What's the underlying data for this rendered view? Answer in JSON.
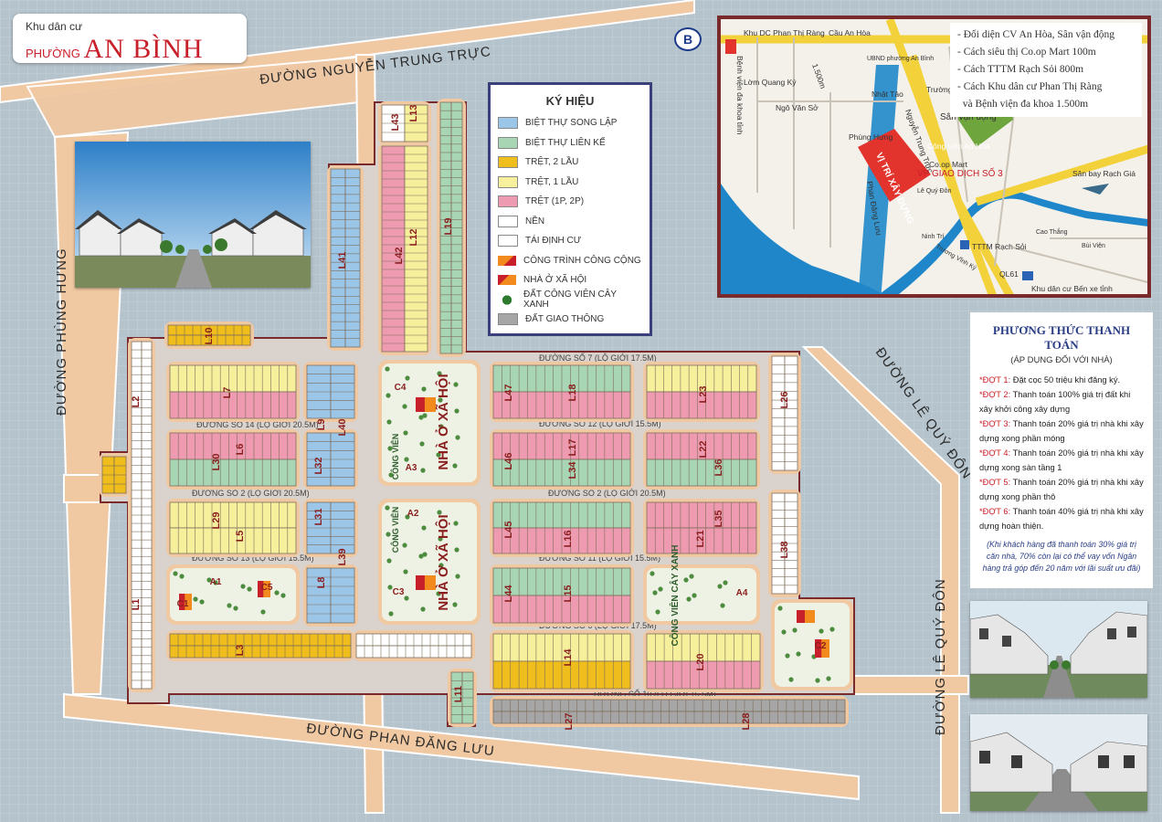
{
  "title": {
    "line1": "Khu dân cư",
    "prefix": "PHƯỜNG",
    "name": "AN BÌNH"
  },
  "north_badge": "B",
  "roads": {
    "nguyen_trung_truc": "ĐƯỜNG NGUYỄN TRUNG TRỰC",
    "phung_hung": "ĐƯỜNG PHÙNG HƯNG",
    "phan_dang_luu": "ĐƯỜNG PHAN ĐĂNG LƯU",
    "le_quy_don": "ĐƯỜNG LÊ QUÝ ĐÔN",
    "duong_so_7": "ĐƯỜNG SỐ 7 (LỘ GIỚI 17.5M)",
    "duong_so_14": "ĐƯỜNG SỐ 14 (LỘ GIỚI 20.5M)",
    "duong_so_12": "ĐƯỜNG SỐ 12 (LỘ GIỚI 15.5M)",
    "duong_so_2": "ĐƯỜNG SỐ 2 (LỘ GIỚI 20.5M)",
    "duong_so_13": "ĐƯỜNG SỐ 13 (LỘ GIỚI 15.5M)",
    "duong_so_11": "ĐƯỜNG SỐ 11 (LỘ GIỚI 15.5M)",
    "duong_so_6": "ĐƯỜNG SỐ 6 (LỘ GIỚI 17.5M)",
    "duong_so_10": "ĐƯỜNG SỐ 10 (LỘ GIỚI 15.5M)"
  },
  "legend": {
    "title": "KÝ HIỆU",
    "items": [
      {
        "label": "BIỆT THỰ SONG LẬP",
        "color": "#9cc6e8"
      },
      {
        "label": "BIỆT THỰ LIÊN KẾ",
        "color": "#a8d6b4"
      },
      {
        "label": "TRỆT, 2 LẦU",
        "color": "#efbd1c"
      },
      {
        "label": "TRỆT, 1 LẦU",
        "color": "#f6ef9c"
      },
      {
        "label": "TRỆT (1P, 2P)",
        "color": "#ee9ab0"
      },
      {
        "label": "NỀN",
        "color": "#ffffff"
      },
      {
        "label": "TÁI ĐỊNH CƯ",
        "color": "#ffffff"
      },
      {
        "label": "CÔNG TRÌNH CÔNG CỘNG",
        "icon": "public-building-icon"
      },
      {
        "label": "NHÀ Ở XÃ HỘI",
        "icon": "social-housing-icon"
      },
      {
        "label": "ĐẤT CÔNG VIÊN CÂY XANH",
        "icon": "park-tree-icon"
      },
      {
        "label": "ĐẤT GIAO THÔNG",
        "color": "#a6a6a6"
      }
    ]
  },
  "location_map": {
    "notes": [
      "- Đối diện CV An Hòa, Sân vận động",
      "- Cách siêu thị Co.op Mart 100m",
      "- Cách TTTM Rạch Sỏi 800m",
      "- Cách Khu dân cư Phan Thị Ràng",
      "  và Bệnh viện đa khoa 1.500m"
    ],
    "labels": {
      "khu_dc": "Khu DC Phan Thị Ràng",
      "benh_vien": "Bệnh viện đa khoa tỉnh",
      "cau_an_hoa": "Cầu An Hòa",
      "ubnd": "UBND phường An Bình",
      "lom_quang_ky": "Lờm Quang Ký",
      "ngo_van_so": "Ngô Văn Sở",
      "distance": "1.500m",
      "nhat_tao": "Nhật Tảo",
      "truong_dinh": "Trường Định",
      "nguyen_trung_truc": "Nguyễn Trung Trực",
      "san_van_dong": "Sân vận động",
      "phung_hung": "Phùng Hưng",
      "cong_vien": "Công viên An Hòa",
      "coop": "Co.op Mart",
      "giao_dich": "VP GIAO DỊCH SỐ 3",
      "vi_tri": "VỊ TRÍ XÂY DỰNG",
      "san_bay": "Sân bay Rạch Giá",
      "phan_dang_luu": "Phan Đăng Lưu",
      "le_quy_don": "Lê Quý Đôn",
      "tttm": "TTTM Rạch Sỏi",
      "ninh_tri": "Ninh Trí",
      "truong_vinh_ky": "Trương Vĩnh Ký",
      "ql61": "QL61",
      "bui_vien": "Bùi Viện",
      "cao_thang": "Cao Thắng",
      "ben_xe": "Khu dân cư Bến xe tỉnh"
    }
  },
  "payment": {
    "title": "PHƯƠNG THỨC THANH TOÁN",
    "subtitle": "(ÁP DỤNG ĐỐI VỚI NHÀ)",
    "rows": [
      {
        "label": "*ĐỢT 1:",
        "text": "Đặt cọc 50 triệu khi đăng ký."
      },
      {
        "label": "*ĐỢT 2:",
        "text": "Thanh toán 100% giá trị đất khi xây khởi công xây dựng"
      },
      {
        "label": "*ĐỢT 3:",
        "text": "Thanh toán 20% giá trị nhà khi xây dựng xong phần móng"
      },
      {
        "label": "*ĐỢT 4:",
        "text": "Thanh toán 20% giá trị nhà khi xây dựng xong sàn tầng 1"
      },
      {
        "label": "*ĐỢT 5:",
        "text": "Thanh toán 20% giá trị nhà khi xây dựng xong phần thô"
      },
      {
        "label": "*ĐỢT 6:",
        "text": "Thanh toán 40% giá trị nhà khi xây dựng hoàn thiện."
      }
    ],
    "note": "(Khi khách hàng đã thanh toán 30% giá trị căn nhà, 70% còn lại có thể vay vốn Ngân hàng trả góp đến 20 năm với lãi suất ưu đãi)"
  },
  "plan": {
    "blocks": [
      "L1",
      "L2",
      "L3",
      "L5",
      "L6",
      "L7",
      "L8",
      "L9",
      "L10",
      "L11",
      "L12",
      "L13",
      "L14",
      "L15",
      "L16",
      "L17",
      "L18",
      "L19",
      "L20",
      "L21",
      "L22",
      "L23",
      "L26",
      "L27",
      "L28",
      "L29",
      "L30",
      "L31",
      "L32",
      "L34",
      "L35",
      "L36",
      "L38",
      "L39",
      "L40",
      "L41",
      "L42",
      "L43",
      "L44",
      "L45",
      "L46",
      "L47"
    ],
    "parks": [
      "A1",
      "A2",
      "A3",
      "A4",
      "C1",
      "C2",
      "C3",
      "C4",
      "C5"
    ],
    "green_labels": {
      "cong_vien": "CÔNG VIÊN",
      "cong_vien_cay_xanh": "CÔNG VIÊN CÂY XANH"
    },
    "social": "NHÀ Ở XÃ HỘI"
  }
}
